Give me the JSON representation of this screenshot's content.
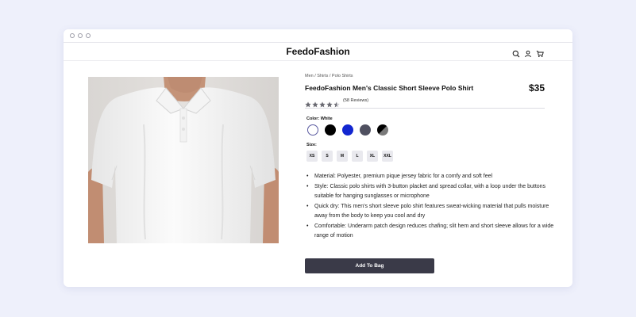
{
  "brand": "FeedoFashion",
  "nav": {
    "icons": [
      "search-icon",
      "user-icon",
      "cart-icon"
    ]
  },
  "product": {
    "breadcrumb": "Men / Shirts / Polo Shirts",
    "title": "FeedoFashion Men's Classic Short Sleeve Polo Shirt",
    "price": "$35",
    "rating": 4.5,
    "reviews": "(58 Reviews)",
    "color_label": "Color: White",
    "colors": [
      {
        "name": "white",
        "hex": "#ffffff",
        "selected": true
      },
      {
        "name": "black",
        "hex": "#000000"
      },
      {
        "name": "blue",
        "hex": "#1226d0"
      },
      {
        "name": "slate",
        "hex": "#4f5060"
      },
      {
        "name": "black-gray",
        "hex": "#000000",
        "hex2": "#7a7a7a"
      }
    ],
    "size_label": "Size:",
    "sizes": [
      "XS",
      "S",
      "M",
      "L",
      "XL",
      "XXL"
    ],
    "features": [
      "Material: Polyester, premium pique jersey fabric for a comfy and soft feel",
      "Style: Classic polo shirts with 3-button placket and spread collar, with a loop under the buttons suitable for hanging sunglasses or microphone",
      "Quick dry: This men's short sleeve polo shirt features sweat-wicking material that pulls moisture away from the body to keep you cool and dry",
      "Comfortable: Underarm patch design reduces chafing; slit hem and short sleeve allows for a wide range of motion"
    ],
    "add_button": "Add To Bag"
  }
}
